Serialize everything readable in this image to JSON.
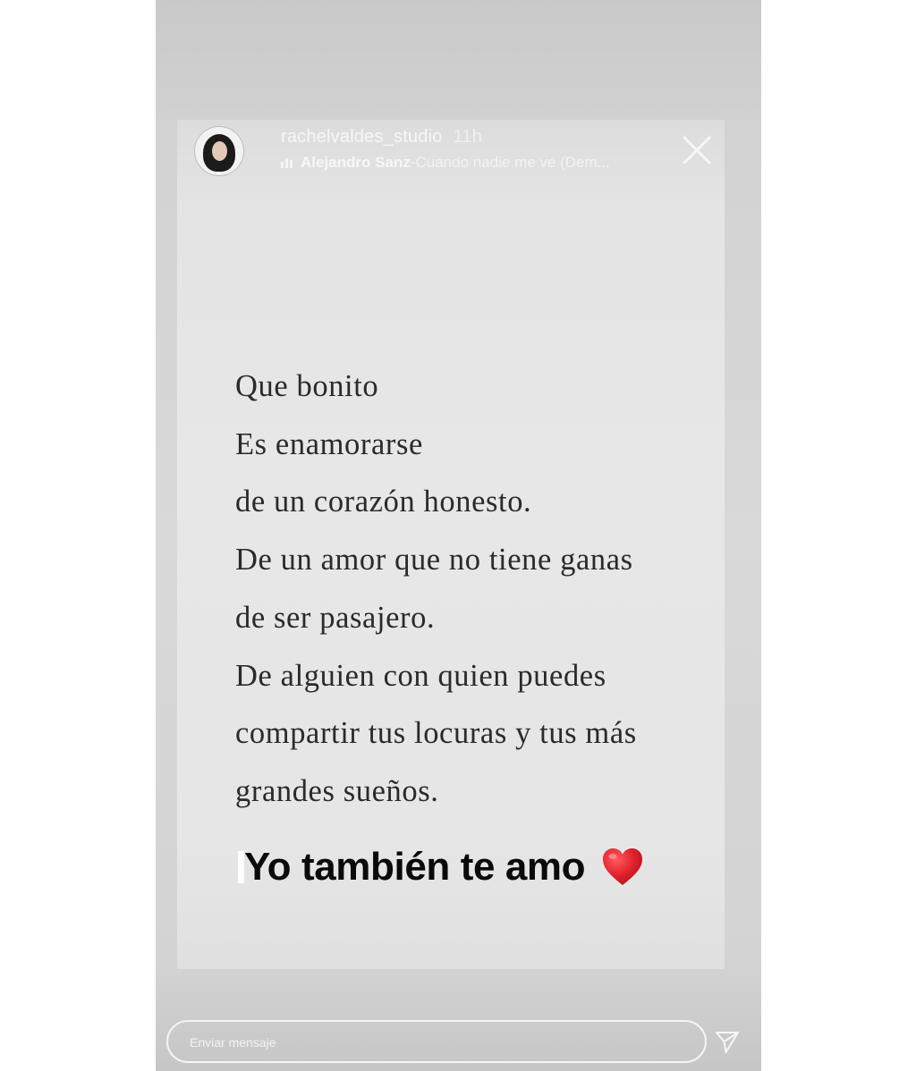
{
  "story": {
    "username": "rachelvaldes_studio",
    "time_ago": "11h",
    "music": {
      "artist": "Alejandro Sanz",
      "separator": " - ",
      "song": "Cuando nadie me ve (Dem..."
    },
    "close_icon": "close-icon",
    "poem_lines": [
      "Que bonito",
      "Es enamorarse",
      "de un corazón honesto.",
      "De un amor que no tiene ganas",
      "de ser pasajero.",
      "De alguien con quien puedes",
      "compartir tus locuras y tus más",
      "grandes sueños."
    ],
    "caption": "Yo también te amo",
    "caption_emoji": "heart-icon"
  },
  "footer": {
    "message_placeholder": "Enviar mensaje",
    "send_icon": "send-icon"
  },
  "colors": {
    "outer_background": "#d3d3d3",
    "card_background": "#e6e6e6",
    "heart": "#d91f2a"
  }
}
